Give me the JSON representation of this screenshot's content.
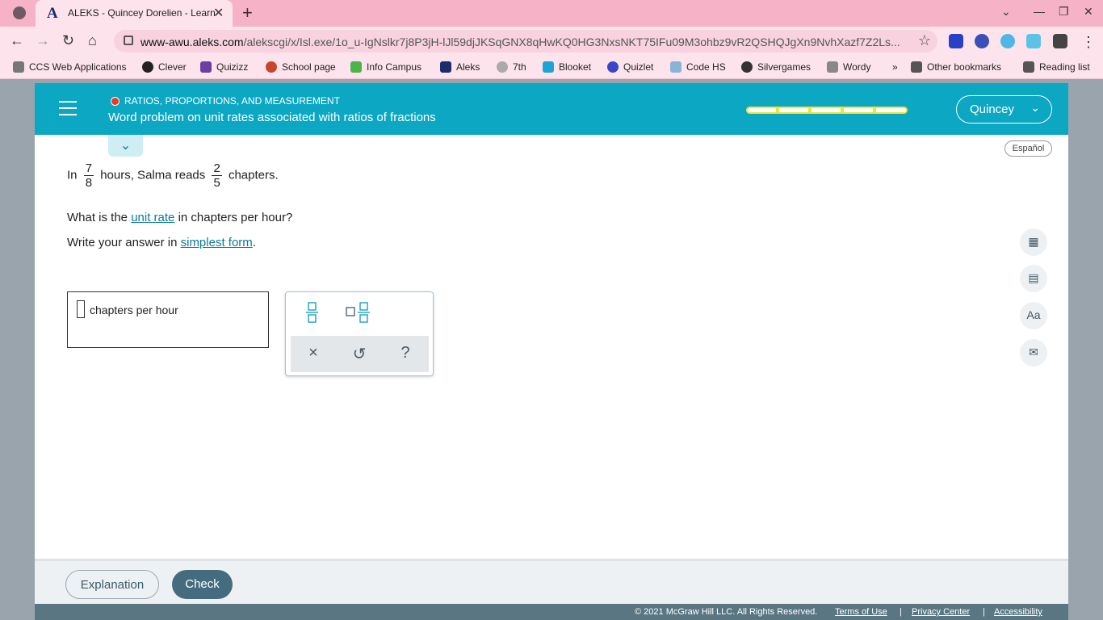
{
  "browser": {
    "tab_title": "ALEKS - Quincey Dorelien - Learn",
    "tab_logo": "A",
    "url_host": "www-awu.aleks.com",
    "url_path": "/alekscgi/x/Isl.exe/1o_u-IgNslkr7j8P3jH-lJl59djJKSqGNX8qHwKQ0HG3NxsNKT75IFu09M3ohbz9vR2QSHQJgXn9NvhXazf7Z2Ls...",
    "bookmarks": [
      "CCS Web Applications",
      "Clever",
      "Quizizz",
      "School page",
      "Info Campus",
      "Aleks",
      "7th",
      "Blooket",
      "Quizlet",
      "Code HS",
      "Silvergames",
      "Wordy"
    ],
    "more": "»",
    "other_bookmarks": "Other bookmarks",
    "reading_list": "Reading list"
  },
  "header": {
    "topic": "RATIOS, PROPORTIONS, AND MEASUREMENT",
    "title": "Word problem on unit rates associated with ratios of fractions",
    "user": "Quincey",
    "language": "Español"
  },
  "question": {
    "line1_pre": "In",
    "frac1_num": "7",
    "frac1_den": "8",
    "line1_mid": "hours, Salma reads",
    "frac2_num": "2",
    "frac2_den": "5",
    "line1_post": "chapters.",
    "line2_pre": "What is the",
    "line2_link": "unit rate",
    "line2_post": "in chapters per hour?",
    "line3_pre": "Write your answer in",
    "line3_link": "simplest form",
    "line3_post": "."
  },
  "answer": {
    "unit": "chapters per hour"
  },
  "keypad": {
    "clear": "×",
    "undo": "↺",
    "help": "?"
  },
  "footer": {
    "explanation": "Explanation",
    "check": "Check",
    "copyright": "© 2021 McGraw Hill LLC. All Rights Reserved.",
    "terms": "Terms of Use",
    "privacy": "Privacy Center",
    "accessibility": "Accessibility",
    "sep": "|"
  },
  "colors": {
    "brand": "#0ba7c3",
    "progress": "#f3e52d",
    "alert_dot": "#e53b2c",
    "check_button": "#456c7e"
  }
}
